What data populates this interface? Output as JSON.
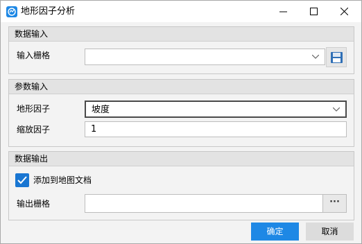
{
  "window": {
    "title": "地形因子分析",
    "icon": "terrain-app-icon",
    "controls": [
      "minimize-icon",
      "maximize-icon",
      "close-icon"
    ]
  },
  "data_input": {
    "header": "数据输入",
    "raster_label": "输入栅格",
    "raster_value": "",
    "save_icon": "floppy-save-icon"
  },
  "params": {
    "header": "参数输入",
    "factor_label": "地形因子",
    "factor_value": "坡度",
    "zoom_label": "缩放因子",
    "zoom_value": "1"
  },
  "data_output": {
    "header": "数据输出",
    "add_to_map_label": "添加到地图文档",
    "add_to_map_checked": true,
    "raster_label": "输出栅格",
    "raster_value": "",
    "browse_label": "···"
  },
  "footer": {
    "ok_label": "确定",
    "cancel_label": "取消"
  },
  "colors": {
    "accent": "#1e88e5",
    "checkbox": "#1976d2",
    "group_header": "#e3e3e3",
    "background": "#f3f3f3"
  }
}
